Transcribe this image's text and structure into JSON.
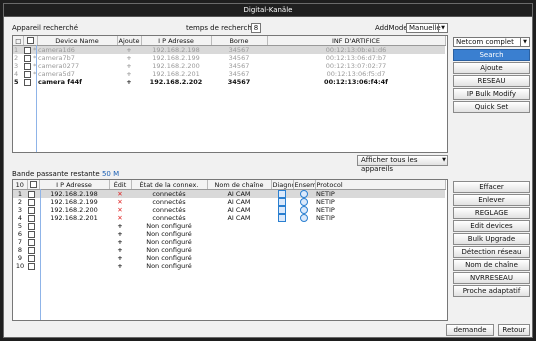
{
  "window": {
    "title": "Digital-Kanäle"
  },
  "top": {
    "section_label": "Appareil recherché",
    "search_time_label": "temps de recherche",
    "search_time_value": "8",
    "addmode_label": "AddMode",
    "addmode_value": "Manuelle",
    "columns": [
      "",
      "",
      "Device Name",
      "Ajoute",
      "I P Adresse",
      "Borne",
      "INF D'ARTIFICE"
    ],
    "rows": [
      {
        "num": "1",
        "star": "*",
        "name": "camera1d6",
        "add": "+",
        "ip": "192.168.2.198",
        "port": "34567",
        "mac": "00:12:13:0b:e1:d6",
        "style": "grey-hl"
      },
      {
        "num": "2",
        "star": "*",
        "name": "camera7b7",
        "add": "+",
        "ip": "192.168.2.199",
        "port": "34567",
        "mac": "00:12:13:06:d7:b7",
        "style": "grey"
      },
      {
        "num": "3",
        "star": "*",
        "name": "camera0277",
        "add": "+",
        "ip": "192.168.2.200",
        "port": "34567",
        "mac": "00:12:13:07:02:77",
        "style": "grey"
      },
      {
        "num": "4",
        "star": "*",
        "name": "camera5d7",
        "add": "+",
        "ip": "192.168.2.201",
        "port": "34567",
        "mac": "00:12:13:06:f5:d7",
        "style": "grey"
      },
      {
        "num": "5",
        "star": "",
        "name": "camera f44f",
        "add": "+",
        "ip": "192.168.2.202",
        "port": "34567",
        "mac": "00:12:13:06:f4:4f",
        "style": "bold"
      }
    ],
    "show_all_label": "Afficher tous les appareils"
  },
  "right_top": {
    "protocol_value": "Netcom complet",
    "buttons": [
      "Search",
      "Ajoute",
      "RESEAU",
      "IP Bulk Modify",
      "Quick Set"
    ]
  },
  "bottom": {
    "bandwidth_label": "Bande passante restante",
    "bandwidth_value": "50 M",
    "columns": [
      "10",
      "",
      "I P Adresse",
      "Édit",
      "État de la connex.",
      "Nom de chaîne",
      "Diagnostic",
      "Ensemble",
      "Protocol"
    ],
    "rows": [
      {
        "num": "1",
        "ip": "192.168.2.198",
        "edit": "x",
        "state": "connectés",
        "channel": "AI CAM",
        "diag": true,
        "set": true,
        "proto": "NETIP",
        "hl": true
      },
      {
        "num": "2",
        "ip": "192.168.2.199",
        "edit": "x",
        "state": "connectés",
        "channel": "AI CAM",
        "diag": true,
        "set": true,
        "proto": "NETIP",
        "hl": false
      },
      {
        "num": "3",
        "ip": "192.168.2.200",
        "edit": "x",
        "state": "connectés",
        "channel": "AI CAM",
        "diag": true,
        "set": true,
        "proto": "NETIP",
        "hl": false
      },
      {
        "num": "4",
        "ip": "192.168.2.201",
        "edit": "x",
        "state": "connectés",
        "channel": "AI CAM",
        "diag": true,
        "set": true,
        "proto": "NETIP",
        "hl": false
      },
      {
        "num": "5",
        "ip": "",
        "edit": "+",
        "state": "Non configuré",
        "channel": "",
        "diag": false,
        "set": false,
        "proto": "",
        "hl": false
      },
      {
        "num": "6",
        "ip": "",
        "edit": "+",
        "state": "Non configuré",
        "channel": "",
        "diag": false,
        "set": false,
        "proto": "",
        "hl": false
      },
      {
        "num": "7",
        "ip": "",
        "edit": "+",
        "state": "Non configuré",
        "channel": "",
        "diag": false,
        "set": false,
        "proto": "",
        "hl": false
      },
      {
        "num": "8",
        "ip": "",
        "edit": "+",
        "state": "Non configuré",
        "channel": "",
        "diag": false,
        "set": false,
        "proto": "",
        "hl": false
      },
      {
        "num": "9",
        "ip": "",
        "edit": "+",
        "state": "Non configuré",
        "channel": "",
        "diag": false,
        "set": false,
        "proto": "",
        "hl": false
      },
      {
        "num": "10",
        "ip": "",
        "edit": "+",
        "state": "Non configuré",
        "channel": "",
        "diag": false,
        "set": false,
        "proto": "",
        "hl": false
      }
    ]
  },
  "right_bottom": {
    "buttons": [
      "Effacer",
      "Enlever",
      "REGLAGE",
      "Edit devices",
      "Bulk Upgrade",
      "Détection réseau",
      "Nom de chaîne",
      "NVRRESEAU",
      "Proche adaptatif"
    ]
  },
  "footer": {
    "demande_label": "demande",
    "retour_label": "Retour"
  },
  "colors": {
    "primary_button": "#3a7fd0",
    "bandwidth_value": "#1a5fb4",
    "edit_delete": "#e02020"
  }
}
